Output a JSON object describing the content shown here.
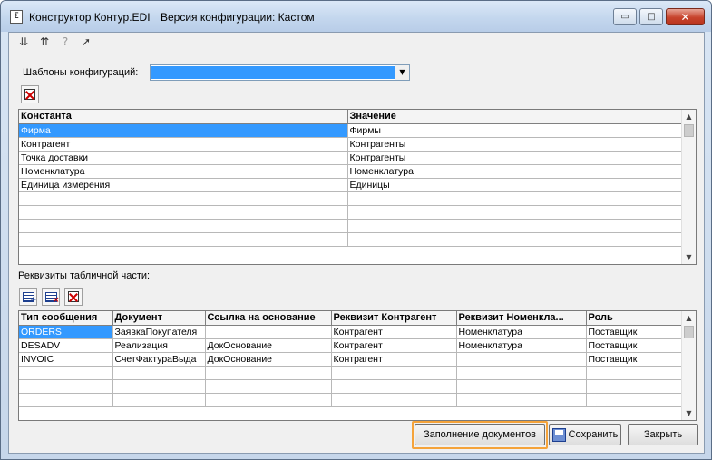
{
  "window": {
    "app_title": "Конструктор Контур.EDI",
    "config_title": "Версия конфигурации: Кастом"
  },
  "toolbar": {
    "icons": [
      "load-config-icon",
      "save-config-icon",
      "help-icon",
      "pointer-help-icon"
    ]
  },
  "templates": {
    "label": "Шаблоны конфигураций:",
    "selected_value": ""
  },
  "constants_grid": {
    "columns": [
      "Константа",
      "Значение"
    ],
    "rows": [
      [
        "Фирма",
        "Фирмы"
      ],
      [
        "Контрагент",
        "Контрагенты"
      ],
      [
        "Точка доставки",
        "Контрагенты"
      ],
      [
        "Номенклатура",
        "Номенклатура"
      ],
      [
        "Единица измерения",
        "Единицы"
      ]
    ],
    "selected_row": 0
  },
  "details_section": {
    "label": "Реквизиты табличной части:"
  },
  "messages_grid": {
    "columns": [
      "Тип сообщения",
      "Документ",
      "Ссылка на основание",
      "Реквизит Контрагент",
      "Реквизит Номенкла...",
      "Роль"
    ],
    "rows": [
      [
        "ORDERS",
        "ЗаявкаПокупателя",
        "",
        "Контрагент",
        "Номенклатура",
        "Поставщик"
      ],
      [
        "DESADV",
        "Реализация",
        "ДокОснование",
        "Контрагент",
        "Номенклатура",
        "Поставщик"
      ],
      [
        "INVOIC",
        "СчетФактураВыда",
        "ДокОснование",
        "Контрагент",
        "",
        "Поставщик"
      ]
    ],
    "selected_row": 0
  },
  "buttons": {
    "fill_documents": "Заполнение документов",
    "save": "Сохранить",
    "close": "Закрыть"
  },
  "colors": {
    "selection": "#3399ff",
    "highlight": "#f5a33a"
  }
}
